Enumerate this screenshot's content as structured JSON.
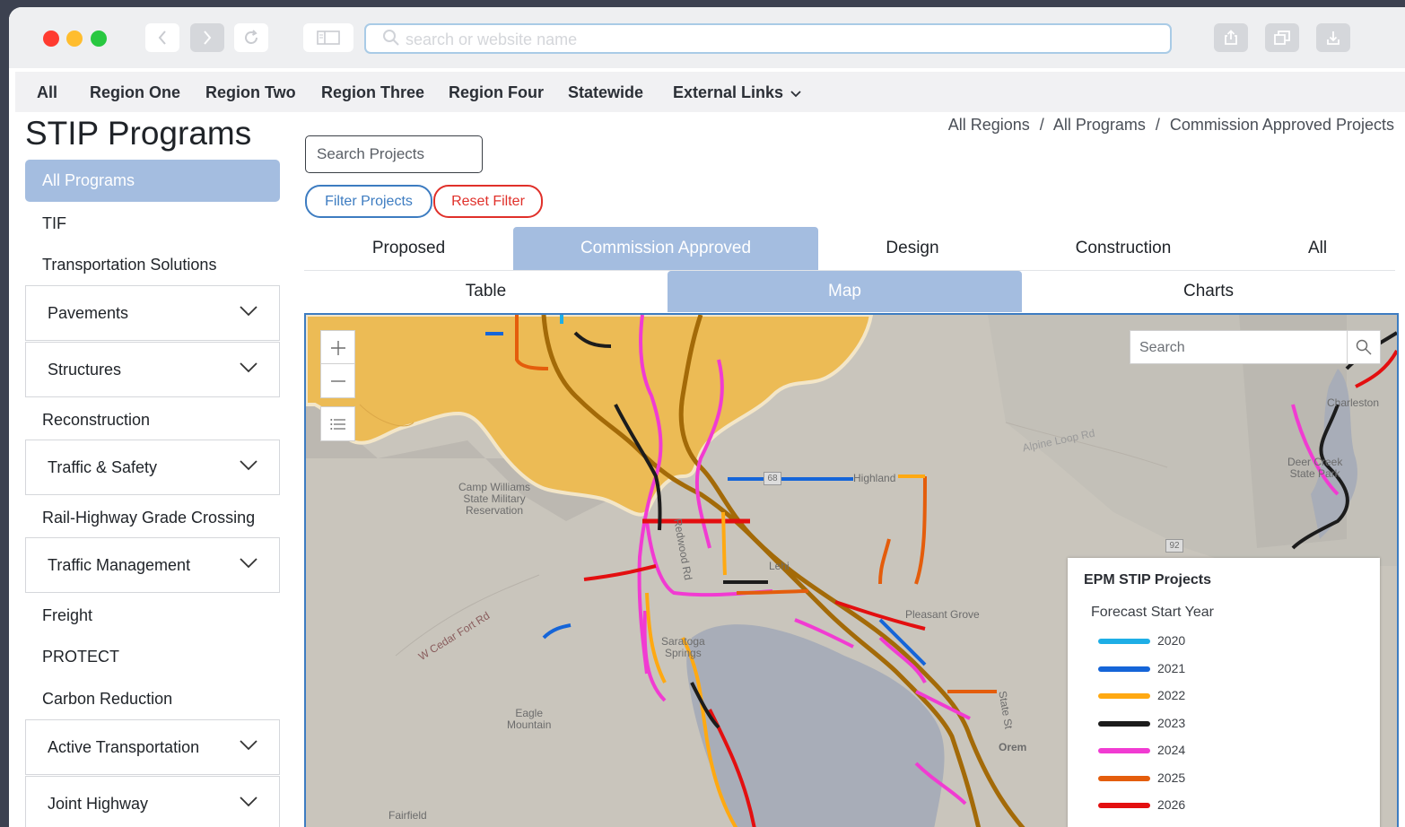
{
  "browser": {
    "url_placeholder": "search or website name"
  },
  "topnav": {
    "items": [
      "All",
      "Region One",
      "Region Two",
      "Region Three",
      "Region Four",
      "Statewide",
      "External Links"
    ]
  },
  "sidebar": {
    "title": "STIP Programs",
    "active": "All Programs",
    "items": [
      {
        "label": "TIF",
        "expandable": false
      },
      {
        "label": "Transportation Solutions",
        "expandable": false
      },
      {
        "label": "Pavements",
        "expandable": true
      },
      {
        "label": "Structures",
        "expandable": true
      },
      {
        "label": "Reconstruction",
        "expandable": false
      },
      {
        "label": "Traffic & Safety",
        "expandable": true
      },
      {
        "label": "Rail-Highway Grade Crossing",
        "expandable": false
      },
      {
        "label": "Traffic Management",
        "expandable": true
      },
      {
        "label": "Freight",
        "expandable": false
      },
      {
        "label": "PROTECT",
        "expandable": false
      },
      {
        "label": "Carbon Reduction",
        "expandable": false
      },
      {
        "label": "Active Transportation",
        "expandable": true
      },
      {
        "label": "Joint Highway",
        "expandable": true
      }
    ]
  },
  "main": {
    "search_placeholder": "Search Projects",
    "filter_label": "Filter Projects",
    "reset_label": "Reset Filter",
    "breadcrumb": [
      "All Regions",
      "All Programs",
      "Commission Approved Projects"
    ],
    "breadcrumb_sep": "/",
    "status_tabs": [
      "Proposed",
      "Commission Approved",
      "Design",
      "Construction",
      "All"
    ],
    "status_active": "Commission Approved",
    "view_tabs": [
      "Table",
      "Map",
      "Charts"
    ],
    "view_active": "Map"
  },
  "map": {
    "search_placeholder": "Search",
    "labels": {
      "camp": "Camp Williams\nState Military\nReservation",
      "highland": "Highland",
      "lehi": "Lehi",
      "pleasant_grove": "Pleasant Grove",
      "saratoga": "Saratoga\nSprings",
      "eagle": "Eagle\nMountain",
      "orem": "Orem",
      "fairfield": "Fairfield",
      "redwood": "Redwood Rd",
      "cedar": "W Cedar Fort Rd",
      "state_st": "State St",
      "alpine": "Alpine Loop Rd",
      "charleston": "Charleston",
      "deer_creek": "Deer Creek\nState Park",
      "shield_92": "92",
      "shield_68": "68"
    },
    "legend": {
      "title": "EPM STIP Projects",
      "subtitle": "Forecast Start Year",
      "entries": [
        {
          "year": "2020",
          "color": "#1eaee6"
        },
        {
          "year": "2021",
          "color": "#1565d8"
        },
        {
          "year": "2022",
          "color": "#ffa912"
        },
        {
          "year": "2023",
          "color": "#1c1c1c"
        },
        {
          "year": "2024",
          "color": "#f13bd2"
        },
        {
          "year": "2025",
          "color": "#e45d0c"
        },
        {
          "year": "2026",
          "color": "#e30f10"
        }
      ]
    }
  }
}
